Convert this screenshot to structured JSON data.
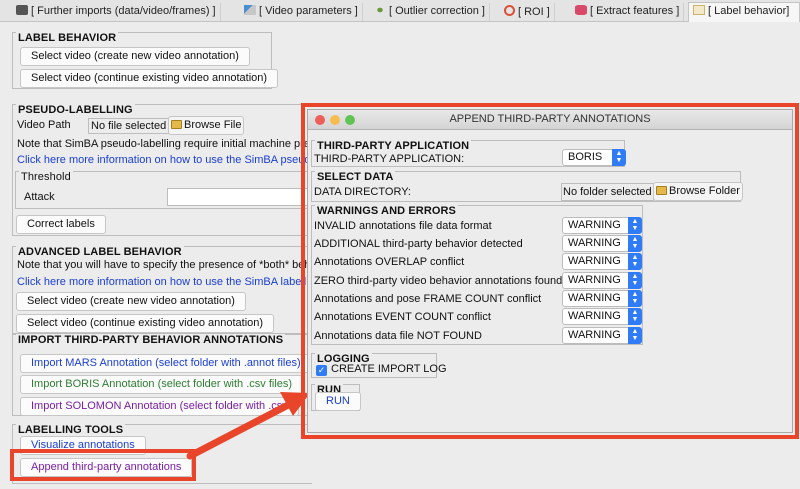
{
  "tabs": [
    {
      "label": "[ Further imports (data/video/frames) ]",
      "icon": "import-icon"
    },
    {
      "label": "[ Video parameters ]",
      "icon": "pencil-icon"
    },
    {
      "label": "[ Outlier correction ]",
      "icon": "outlier-icon"
    },
    {
      "label": "[ ROI ]",
      "icon": "roi-icon"
    },
    {
      "label": "[ Extract features ]",
      "icon": "database-icon"
    },
    {
      "label": "[ Label behavior]",
      "icon": "label-icon"
    }
  ],
  "label_behavior": {
    "title": "LABEL BEHAVIOR",
    "btn_create": "Select video (create new video annotation)",
    "btn_continue": "Select video (continue existing video annotation)"
  },
  "pseudo": {
    "title": "PSEUDO-LABELLING",
    "video_path_label": "Video Path",
    "file_value": "No file selected",
    "browse_label": "Browse File",
    "note": "Note that SimBA pseudo-labelling require initial machine pred",
    "link": "Click here more information on how to use the SimBA pseudo",
    "threshold_title": "Threshold",
    "attack_label": "Attack",
    "correct_label": "Correct labels"
  },
  "advanced": {
    "title": "ADVANCED LABEL BEHAVIOR",
    "note": "Note that you will have to specify the presence of *both* beh",
    "link": "Click here more information on how to use the SimBA labelling",
    "btn_create": "Select video (create new video annotation)",
    "btn_continue": "Select video (continue existing video annotation)"
  },
  "import_third": {
    "title": "IMPORT THIRD-PARTY BEHAVIOR ANNOTATIONS",
    "mars": "Import MARS Annotation (select folder with .annot files)",
    "boris": "Import BORIS Annotation (select folder with .csv files)",
    "solomon": "Import SOLOMON Annotation (select folder with .csv",
    "colors": {
      "mars": "#1a3ecf",
      "boris": "#2e7d32",
      "solomon": "#7b1fa2"
    }
  },
  "tools": {
    "title": "LABELLING TOOLS",
    "visualize": "Visualize annotations",
    "append": "Append third-party annotations"
  },
  "dialog": {
    "title": "APPEND THIRD-PARTY ANNOTATIONS",
    "app_section": "THIRD-PARTY APPLICATION",
    "app_label": "THIRD-PARTY APPLICATION:",
    "app_value": "BORIS",
    "data_section": "SELECT DATA",
    "dir_label": "DATA DIRECTORY:",
    "dir_value": "No folder selected",
    "browse_folder": "Browse Folder",
    "warn_section": "WARNINGS AND ERRORS",
    "warnings": [
      {
        "label": "INVALID annotations file data format",
        "value": "WARNING"
      },
      {
        "label": "ADDITIONAL third-party behavior detected",
        "value": "WARNING"
      },
      {
        "label": "Annotations OVERLAP conflict",
        "value": "WARNING"
      },
      {
        "label": "ZERO third-party video behavior annotations found",
        "value": "WARNING"
      },
      {
        "label": "Annotations and pose FRAME COUNT conflict",
        "value": "WARNING"
      },
      {
        "label": "Annotations EVENT COUNT conflict",
        "value": "WARNING"
      },
      {
        "label": "Annotations data file NOT FOUND",
        "value": "WARNING"
      }
    ],
    "log_section": "LOGGING",
    "log_label": "CREATE IMPORT LOG",
    "log_checked": true,
    "run_section": "RUN",
    "run_label": "RUN"
  },
  "colors": {
    "highlight": "#e8452a",
    "accent": "#2f7cf6"
  }
}
